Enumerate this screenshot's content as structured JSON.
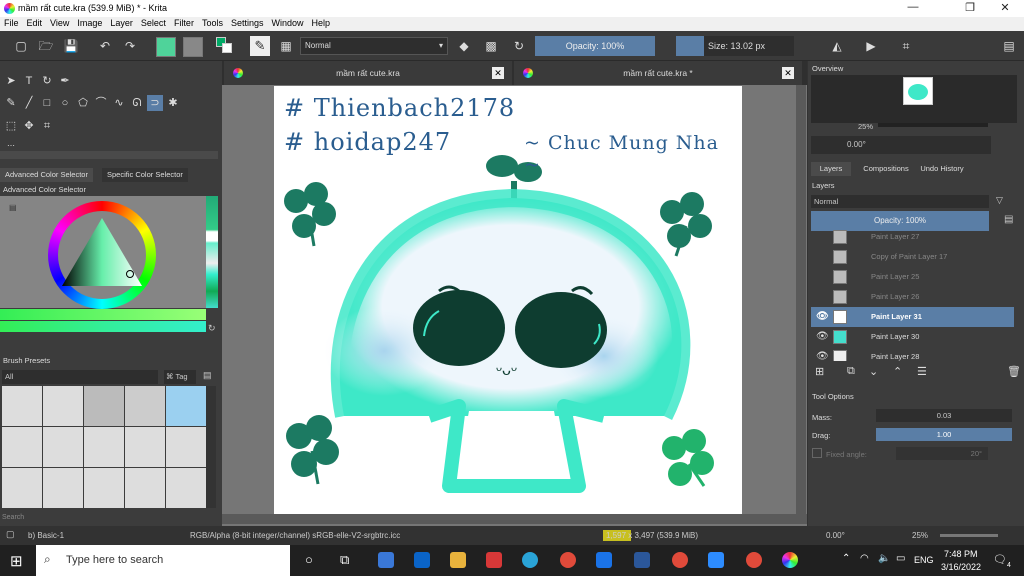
{
  "window": {
    "title": "mầm rất cute.kra (539.9 MiB)  * - Krita",
    "controls": [
      "—",
      "❐",
      "✕"
    ]
  },
  "menu": [
    "File",
    "Edit",
    "View",
    "Image",
    "Layer",
    "Select",
    "Filter",
    "Tools",
    "Settings",
    "Window",
    "Help"
  ],
  "toolbar": {
    "blend_mode": "Normal",
    "opacity": "Opacity: 100%",
    "size": "Size: 13.02 px"
  },
  "left_panel": {
    "tabs": [
      "Advanced Color Selector",
      "Specific Color Selector"
    ],
    "color_selector_title": "Advanced Color Selector",
    "brush_presets_title": "Brush Presets",
    "brush_filter": "All",
    "tag_label": "Tag",
    "search_placeholder": "Search"
  },
  "document_tabs": [
    {
      "label": "mầm rất cute.kra"
    },
    {
      "label": "mầm rất cute.kra *"
    }
  ],
  "canvas_art": {
    "line1": "# Thienbach2178",
    "line2": "# hoidap247",
    "line3": "~ Chuc Mung Nha ~",
    "face": "ᵕᴗᵕ"
  },
  "right_panel": {
    "overview_title": "Overview",
    "zoom": "25%",
    "rotation": "0.00°",
    "tabs": [
      "Layers",
      "Compositions",
      "Undo History"
    ],
    "layers_title": "Layers",
    "blend_mode": "Normal",
    "opacity": "Opacity: 100%",
    "layers": [
      {
        "name": "Paint Layer 27",
        "visible": false,
        "selected": false
      },
      {
        "name": "Copy of Paint Layer 17",
        "visible": false,
        "selected": false
      },
      {
        "name": "Paint Layer 25",
        "visible": false,
        "selected": false
      },
      {
        "name": "Paint Layer 26",
        "visible": false,
        "selected": false
      },
      {
        "name": "Paint Layer 31",
        "visible": true,
        "selected": true
      },
      {
        "name": "Paint Layer 30",
        "visible": true,
        "selected": false
      },
      {
        "name": "Paint Layer 28",
        "visible": true,
        "selected": false
      }
    ],
    "tool_options_title": "Tool Options",
    "mass_label": "Mass:",
    "mass_value": "0.03",
    "drag_label": "Drag:",
    "drag_value": "1.00",
    "fixed_angle_label": "Fixed angle:",
    "fixed_angle_value": "20°"
  },
  "status": {
    "brush": "b) Basic-1",
    "color_space": "RGB/Alpha (8-bit integer/channel)  sRGB-elle-V2-srgbtrc.icc",
    "size": "1,597 x 3,497 (539.9 MiB)",
    "rotation": "0.00°",
    "zoom": "25%"
  },
  "taskbar": {
    "search_placeholder": "Type here to search",
    "language": "ENG",
    "time": "7:48 PM",
    "date": "3/16/2022",
    "notifications": "4"
  },
  "colors": {
    "accent": "#5a7ea6",
    "mint": "#3ee8c8",
    "dark_green": "#1c7a62",
    "title_text": "#2a5d8f"
  }
}
